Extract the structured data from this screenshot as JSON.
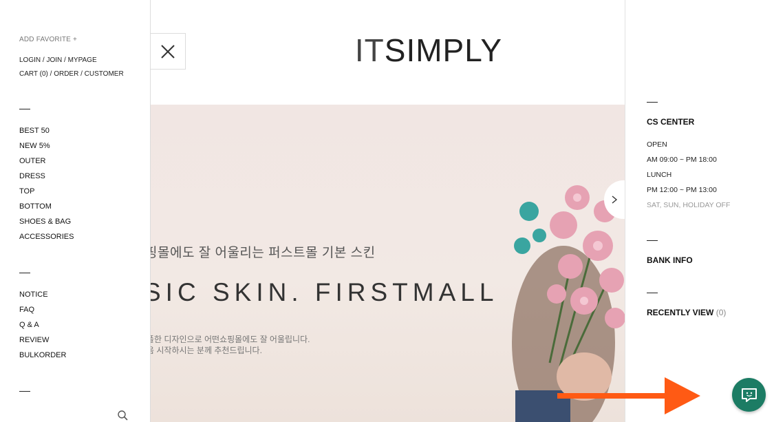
{
  "sidebar": {
    "add_favorite": "ADD FAVORITE +",
    "account_line1": "LOGIN / JOIN / MYPAGE",
    "account_line2": "CART (0) / ORDER / CUSTOMER",
    "categories": [
      "BEST 50",
      "NEW 5%",
      "OUTER",
      "DRESS",
      "TOP",
      "BOTTOM",
      "SHOES & BAG",
      "ACCESSORIES"
    ],
    "board": [
      "NOTICE",
      "FAQ",
      "Q & A",
      "REVIEW",
      "BULKORDER"
    ],
    "search_icon": "search-icon"
  },
  "header": {
    "logo_part1": "IT",
    "logo_part2": "SIMPLY",
    "close_icon": "close-icon"
  },
  "banner": {
    "subtitle": "핑몰에도 잘 어울리는 퍼스트몰 기본 스킨",
    "headline": "SIC SKIN. FIRSTMALL",
    "desc_line1": "플한 디자인으로 어떤쇼핑몰에도 잘 어울립니다.",
    "desc_line2": "음 시작하시는 분께 추천드립니다.",
    "next_icon": "chevron-right-icon"
  },
  "right_sidebar": {
    "cs_title": "CS CENTER",
    "open_label": "OPEN",
    "open_hours": "AM 09:00 ~ PM 18:00",
    "lunch_label": "LUNCH",
    "lunch_hours": "PM 12:00 ~ PM 13:00",
    "holiday": "SAT, SUN, HOLIDAY OFF",
    "bank_title": "BANK INFO",
    "recent_title": "RECENTLY VIEW",
    "recent_count": "(0)"
  },
  "colors": {
    "accent_arrow": "#ff5a14",
    "chat_button": "#1c7c64",
    "banner_bg": "#f1e6e3"
  },
  "chat": {
    "icon": "chat-icon"
  }
}
